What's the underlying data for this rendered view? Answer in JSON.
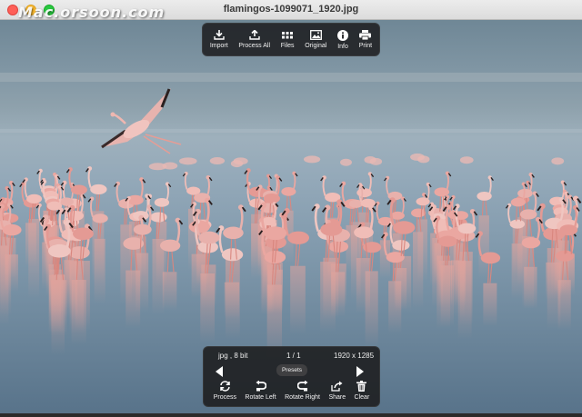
{
  "window": {
    "title": "flamingos-1099071_1920.jpg",
    "watermark": "Mac.orsoon.com"
  },
  "toolbar": {
    "items": [
      {
        "label": "Import",
        "icon": "import-icon"
      },
      {
        "label": "Process All",
        "icon": "upload-icon"
      },
      {
        "label": "Files",
        "icon": "grid-icon"
      },
      {
        "label": "Original",
        "icon": "image-icon"
      },
      {
        "label": "Info",
        "icon": "info-icon"
      },
      {
        "label": "Print",
        "icon": "printer-icon"
      }
    ]
  },
  "panel": {
    "format": "jpg , 8 bit",
    "page": "1 / 1",
    "dimensions": "1920 x 1285",
    "presets_label": "Presets",
    "actions": [
      {
        "label": "Process",
        "icon": "process-icon"
      },
      {
        "label": "Rotate Left",
        "icon": "rotate-left-icon"
      },
      {
        "label": "Rotate Right",
        "icon": "rotate-right-icon"
      },
      {
        "label": "Share",
        "icon": "share-icon"
      },
      {
        "label": "Clear",
        "icon": "trash-icon"
      }
    ]
  },
  "colors": {
    "toolbar_bg": "#1c1c1e",
    "water_top": "#8fa6b7",
    "water_bottom": "#5f7b90",
    "flamingo": "#e9a6a0"
  }
}
